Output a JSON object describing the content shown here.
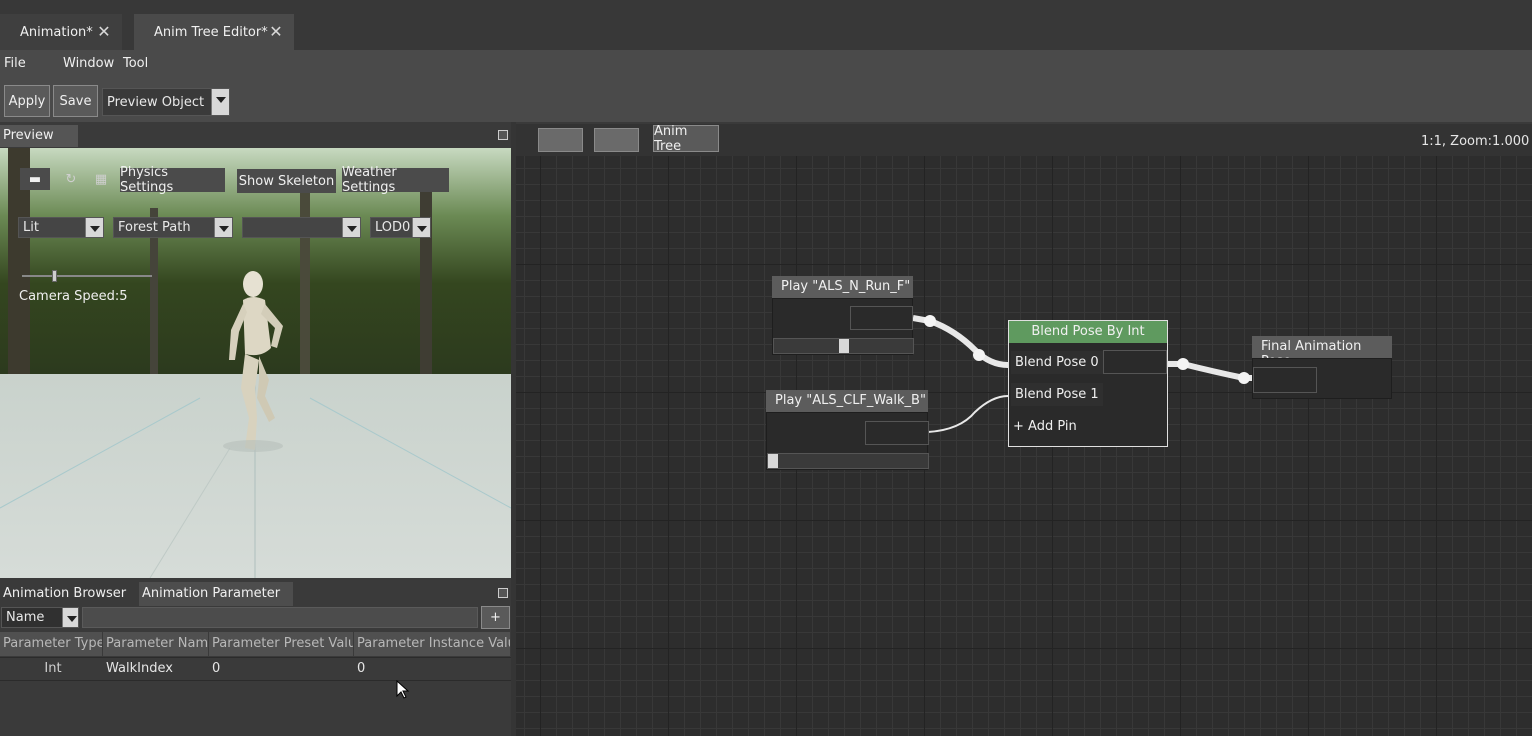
{
  "tabs": [
    {
      "label": "Animation*"
    },
    {
      "label": "Anim Tree Editor*"
    }
  ],
  "menu": [
    "File",
    "Window",
    "Tool"
  ],
  "toolbar": {
    "apply": "Apply",
    "save": "Save",
    "preview_object": "Preview Object"
  },
  "preview": {
    "tab": "Preview",
    "physics_settings": "Physics Settings",
    "show_skeleton": "Show Skeleton",
    "weather_settings": "Weather Settings",
    "lighting_mode": "Lit",
    "environment": "Forest Path",
    "third_combo": "",
    "lod": "LOD0",
    "camera_speed": "Camera Speed:5"
  },
  "bottom": {
    "tabs": [
      "Animation Browser",
      "Animation Parameter"
    ],
    "filter_field": "Name",
    "add_button": "+",
    "columns": [
      "Parameter Type",
      "Parameter Name",
      "Parameter Preset Value",
      "Parameter Instance Value"
    ],
    "rows": [
      {
        "type": "Int",
        "name": "WalkIndex",
        "preset": "0",
        "instance": "0"
      }
    ]
  },
  "graph": {
    "breadcrumb_current": "Anim Tree",
    "zoom_label": "1:1, Zoom:1.000",
    "nodes": {
      "play_run": {
        "title": "Play \"ALS_N_Run_F\""
      },
      "play_walk": {
        "title": "Play \"ALS_CLF_Walk_B\""
      },
      "blend": {
        "title": "Blend Pose By Int",
        "pins": [
          "Blend Pose 0",
          "Blend Pose 1"
        ],
        "add_pin": "+ Add Pin"
      },
      "final": {
        "title": "Final Animation Pose"
      }
    }
  },
  "colors": {
    "blend_header": "#5f9a5f",
    "background": "#3a3a3a"
  }
}
